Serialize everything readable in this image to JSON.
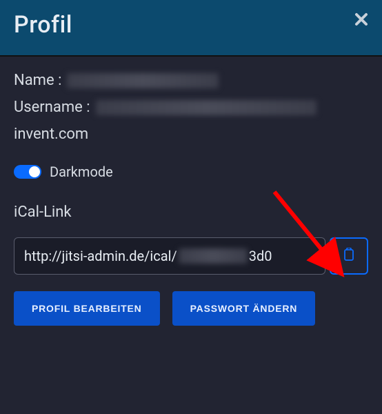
{
  "header": {
    "title": "Profil"
  },
  "profile": {
    "name_label": "Name :",
    "username_label": "Username :",
    "domain": "invent.com",
    "darkmode_label": "Darkmode",
    "darkmode_on": true
  },
  "ical": {
    "label": "iCal-Link",
    "value_prefix": "http://jitsi-admin.de/ical/",
    "value_suffix": "3d0"
  },
  "buttons": {
    "edit_profile": "PROFIL BEARBEITEN",
    "change_password": "PASSWORT ÄNDERN"
  }
}
